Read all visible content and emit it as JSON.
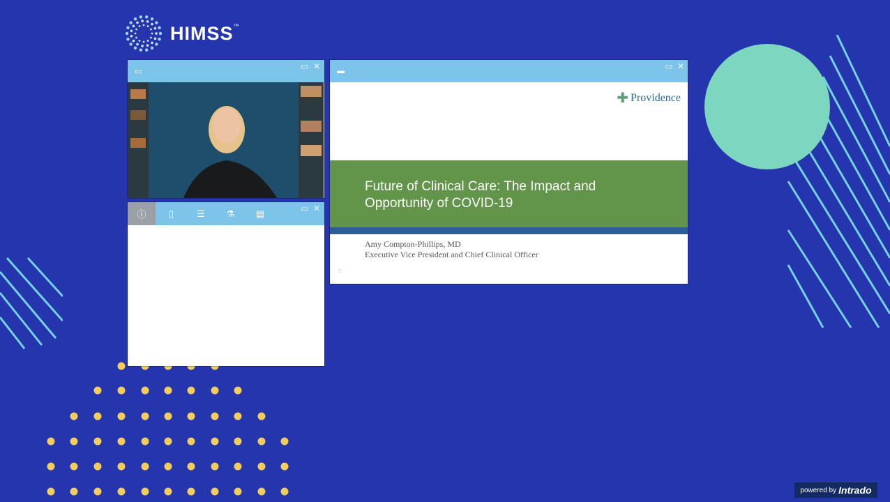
{
  "brand": {
    "name": "HIMSS",
    "trademark": "™"
  },
  "video_window": {
    "icon": "presentation-icon",
    "controls": [
      "maximize-icon",
      "close-icon"
    ]
  },
  "panel_window": {
    "tabs": [
      {
        "name": "info-icon",
        "glyph": "ⓘ",
        "active": true
      },
      {
        "name": "document-icon",
        "glyph": "▯",
        "active": false
      },
      {
        "name": "list-icon",
        "glyph": "☰",
        "active": false
      },
      {
        "name": "flask-icon",
        "glyph": "⚗",
        "active": false
      },
      {
        "name": "notes-icon",
        "glyph": "▤",
        "active": false
      }
    ]
  },
  "slide_window": {
    "icon": "chat-icon",
    "provider": "Providence",
    "title": "Future of Clinical Care: The Impact and Opportunity of COVID-19",
    "author": "Amy Compton-Phillips, MD",
    "role": "Executive Vice President and Chief Clinical Officer",
    "page": "2"
  },
  "footer": {
    "powered_by": "powered by",
    "vendor": "Intrado"
  },
  "colors": {
    "background": "#2535ad",
    "titlebar": "#7dc4ea",
    "slide_band": "#62944a",
    "circle": "#7dd6bf",
    "dots": "#f2cc5c",
    "stripes": "#74d3e2"
  }
}
